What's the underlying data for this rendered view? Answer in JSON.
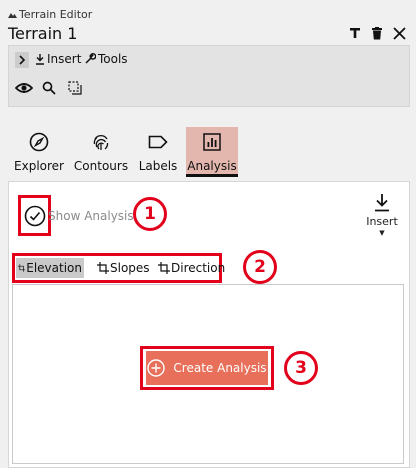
{
  "window": {
    "app_name": "Terrain Editor",
    "doc_title": "Terrain 1",
    "pin_icon": "pin-icon",
    "delete_icon": "trash-icon",
    "close_icon": "close-icon"
  },
  "toolbar": {
    "expand_icon": "chevron-right-icon",
    "insert_label": "Insert",
    "tools_label": "Tools",
    "icons": [
      "eye-icon",
      "search-icon",
      "select-region-icon"
    ]
  },
  "nav_tabs": [
    {
      "label": "Explorer",
      "icon": "compass-icon",
      "active": false
    },
    {
      "label": "Contours",
      "icon": "fingerprint-icon",
      "active": false
    },
    {
      "label": "Labels",
      "icon": "tag-icon",
      "active": false
    },
    {
      "label": "Analysis",
      "icon": "chart-icon",
      "active": true
    }
  ],
  "analysis_panel": {
    "show_analysis_label": "Show Analysis",
    "show_analysis_checked": true,
    "insert_label": "Insert",
    "sub_tabs": [
      {
        "label": "Elevation",
        "active": true
      },
      {
        "label": "Slopes",
        "active": false
      },
      {
        "label": "Direction",
        "active": false
      }
    ],
    "create_label": "Create Analysis"
  },
  "callouts": [
    "1",
    "2",
    "3"
  ],
  "colors": {
    "accent": "#e8705a",
    "active_tab": "#e3b7ad",
    "callout_red": "#e2001a"
  }
}
